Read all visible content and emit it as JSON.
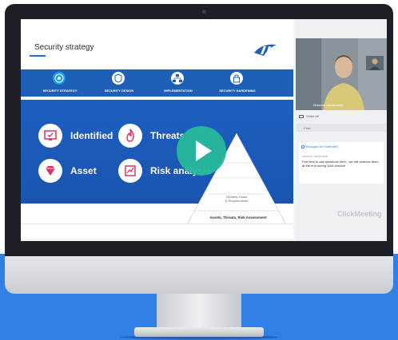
{
  "slide": {
    "title": "Security strategy",
    "nav": [
      {
        "label": "SECURITY STRATEGY",
        "icon": "target-icon",
        "active": true
      },
      {
        "label": "SECURITY DESIGN",
        "icon": "shield-icon",
        "active": false
      },
      {
        "label": "IMPLEMENTATION",
        "icon": "network-icon",
        "active": false
      },
      {
        "label": "SECURITY HARDENING",
        "icon": "lock-icon",
        "active": false
      }
    ],
    "features": [
      {
        "label": "Identified",
        "icon": "monitor-check-icon"
      },
      {
        "label": "Threats",
        "icon": "fire-icon"
      },
      {
        "label": "Asset",
        "icon": "diamond-icon"
      },
      {
        "label": "Risk analysis",
        "icon": "risk-chart-icon"
      }
    ],
    "pyramid": [
      {
        "label": "Security Goals\n& Requirements"
      },
      {
        "label": "Assets, Threats, Risk Assessment"
      }
    ]
  },
  "video": {
    "presenter_name": "Mateusz Jakubowski"
  },
  "panel": {
    "camera_label": "Video off",
    "chat_header": "Chat",
    "chat_note": "Messages are moderated",
    "chat_sender": "Mateusz Jakubowski",
    "chat_message": "Feel free to ask questions here - we will address them at the end during Q&A session"
  },
  "brand": "ClickMeeting",
  "colors": {
    "accent_blue": "#1e5fb8",
    "play_green": "#26b89a",
    "floor_blue": "#2f7fe6"
  }
}
